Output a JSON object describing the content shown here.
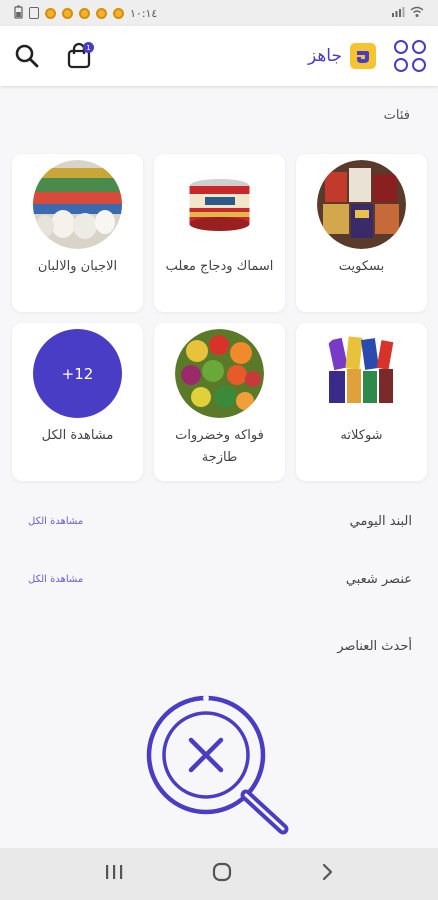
{
  "status_bar": {
    "time": "١٠:١٤",
    "battery_level": 0.5
  },
  "app_bar": {
    "brand_name": "جاهز",
    "cart_count": "1",
    "icons": [
      "search-icon",
      "cart-icon",
      "brand-logo",
      "menu-grid-icon"
    ]
  },
  "categories": {
    "title": "فئات",
    "items": [
      {
        "label": "بسكويت",
        "image": "biscuits-image"
      },
      {
        "label": "اسماك ودجاج معلب",
        "image": "canned-fish-image"
      },
      {
        "label": "الاجبان والالبان",
        "image": "dairy-image"
      },
      {
        "label": "شوكلاته",
        "image": "chocolate-image"
      },
      {
        "label": "فواكه وخضروات طازجة",
        "image": "fruits-vegetables-image"
      },
      {
        "label": "مشاهدة الكل",
        "badge": "+12"
      }
    ]
  },
  "sections": [
    {
      "title": "البند اليومي",
      "view_all": "مشاهدة الكل"
    },
    {
      "title": "عنصر شعبي",
      "view_all": "مشاهدة الكل"
    },
    {
      "title": "أحدث العناصر"
    }
  ],
  "colors": {
    "accent": "#4a3dc5",
    "brand_logo": "#f6c431"
  }
}
